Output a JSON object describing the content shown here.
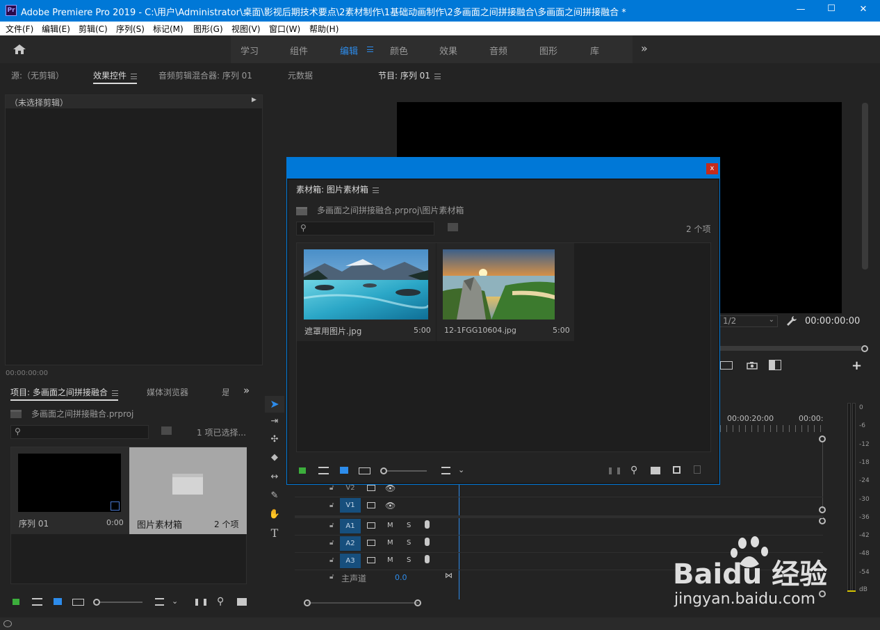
{
  "window": {
    "title": "Adobe Premiere Pro 2019 - C:\\用户\\Administrator\\桌面\\影视后期技术要点\\2素材制作\\1基础动画制作\\2多画面之间拼接融合\\多画面之间拼接融合 *",
    "app_icon": "Pr",
    "min_glyph": "—",
    "max_glyph": "☐",
    "close_glyph": "✕"
  },
  "menu": [
    "文件(F)",
    "编辑(E)",
    "剪辑(C)",
    "序列(S)",
    "标记(M)",
    "图形(G)",
    "视图(V)",
    "窗口(W)",
    "帮助(H)"
  ],
  "workspaces": {
    "items": [
      "学习",
      "组件",
      "编辑",
      "颜色",
      "效果",
      "音频",
      "图形",
      "库"
    ],
    "active": "编辑",
    "more": "»"
  },
  "source_panel": {
    "tabs": [
      "源:（无剪辑）",
      "效果控件",
      "音频剪辑混合器: 序列 01",
      "元数据"
    ],
    "no_clip": "（未选择剪辑）",
    "timecode": "00:00:00:00"
  },
  "program_panel": {
    "tab": "节目: 序列 01",
    "fraction": "1/2",
    "timecode": "00:00:00:00"
  },
  "project_panel": {
    "tabs": [
      "项目: 多画面之间拼接融合",
      "媒体浏览器",
      "是"
    ],
    "path": "多画面之间拼接融合.prproj",
    "selection": "1 项已选择...",
    "items": [
      {
        "name": "序列 01",
        "duration": "0:00"
      },
      {
        "name": "图片素材箱",
        "count": "2 个项"
      }
    ]
  },
  "bin_dialog": {
    "close": "x",
    "title": "素材箱: 图片素材箱",
    "path": "多画面之间拼接融合.prproj\\图片素材箱",
    "count": "2 个项",
    "clips": [
      {
        "name": "遮罩用图片.jpg",
        "duration": "5:00"
      },
      {
        "name": "12-1FGG10604.jpg",
        "duration": "5:00"
      }
    ]
  },
  "timeline": {
    "ruler": [
      "00:00:20:00",
      "00:00:"
    ],
    "video_tracks": [
      "V2",
      "V1"
    ],
    "audio_tracks": [
      "A1",
      "A2",
      "A3"
    ],
    "mute": "M",
    "solo": "S",
    "master": "主声道",
    "master_value": "0.0"
  },
  "vu_meter": {
    "labels": [
      "0",
      "-6",
      "-12",
      "-18",
      "-24",
      "-30",
      "-36",
      "-42",
      "-48",
      "-54",
      "dB"
    ]
  },
  "watermark": {
    "brand": "Baidu 经验",
    "url": "jingyan.baidu.com"
  },
  "colors": {
    "accent": "#0078d7",
    "active_ws": "#2d8ceb",
    "track_blue": "#174f7d",
    "close_red": "#c42b1c"
  }
}
